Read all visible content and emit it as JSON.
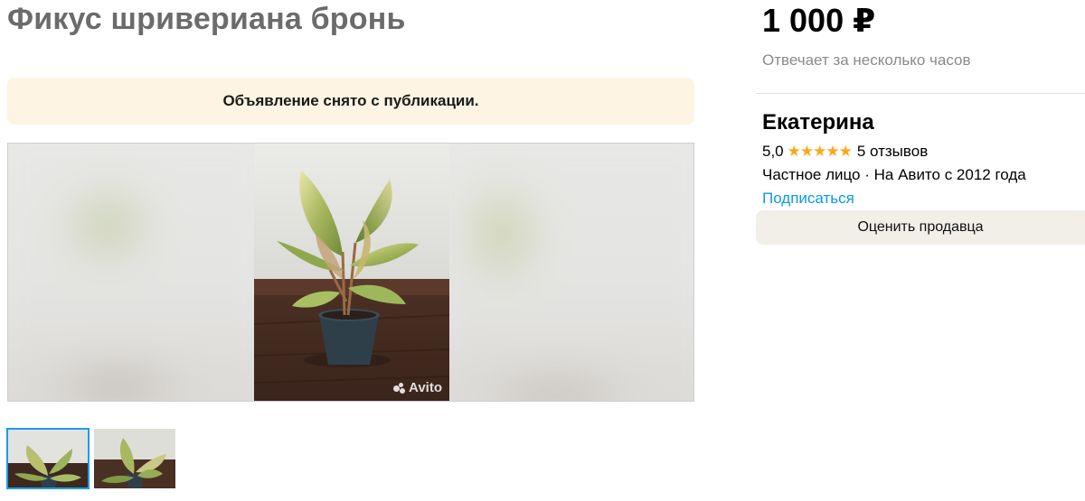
{
  "listing": {
    "title": "Фикус шривериана бронь",
    "notice": "Объявление снято с публикации.",
    "watermark": "Avito",
    "price": "1 000 ₽",
    "response_time": "Отвечает за несколько часов"
  },
  "gallery": {
    "thumbnails": [
      "thumbnail-1",
      "thumbnail-2"
    ],
    "active_index": 0
  },
  "seller": {
    "name": "Екатерина",
    "rating": "5,0",
    "stars": "★★★★★",
    "reviews": "5 отзывов",
    "meta": "Частное лицо · На Авито с 2012 года",
    "subscribe_label": "Подписаться",
    "rate_button_label": "Оценить продавца"
  },
  "colors": {
    "accent_link": "#0a99e8",
    "star": "#ffa71a",
    "notice_bg": "#fdf4e3",
    "thumb_active": "#1e9be9"
  }
}
